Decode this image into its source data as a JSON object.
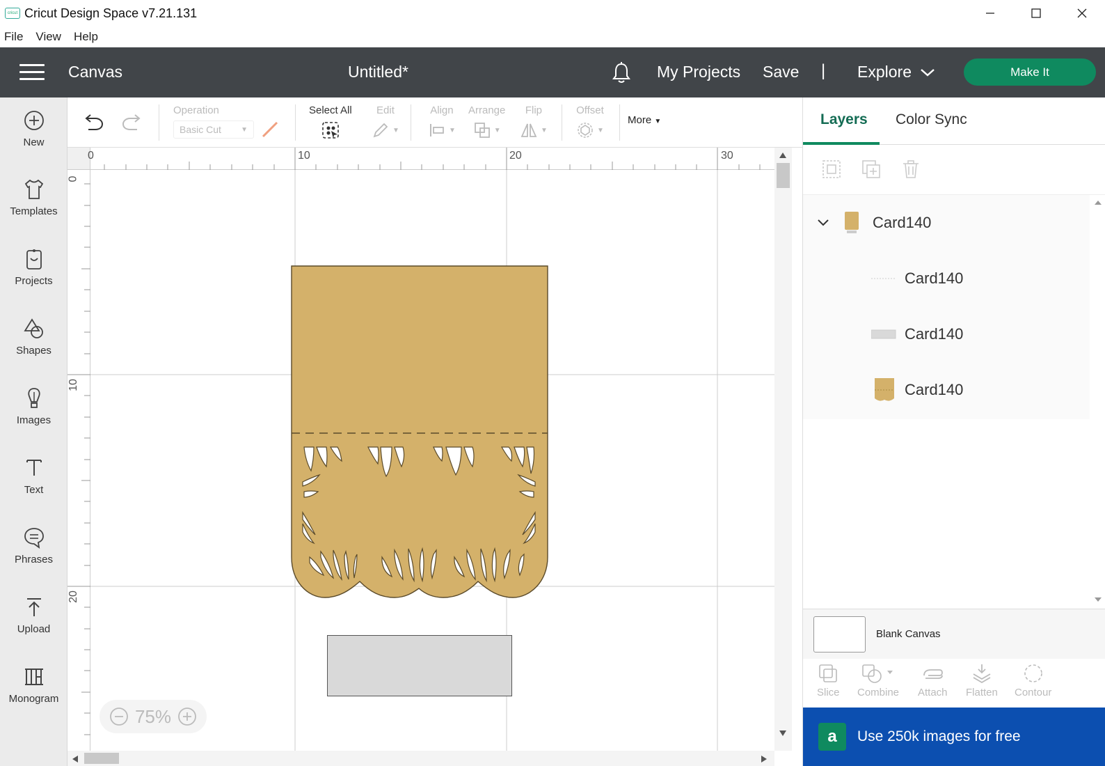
{
  "window": {
    "title": "Cricut Design Space  v7.21.131",
    "logo_text": "cricut"
  },
  "menubar": {
    "items": [
      "File",
      "View",
      "Help"
    ]
  },
  "header": {
    "section": "Canvas",
    "document_title": "Untitled*",
    "my_projects": "My Projects",
    "save": "Save",
    "separator": "|",
    "explore": "Explore",
    "make_it": "Make It"
  },
  "sidebar": {
    "items": [
      {
        "label": "New",
        "icon": "plus-circle-icon"
      },
      {
        "label": "Templates",
        "icon": "tshirt-icon"
      },
      {
        "label": "Projects",
        "icon": "projects-icon"
      },
      {
        "label": "Shapes",
        "icon": "shapes-icon"
      },
      {
        "label": "Images",
        "icon": "lightbulb-icon"
      },
      {
        "label": "Text",
        "icon": "text-icon"
      },
      {
        "label": "Phrases",
        "icon": "speech-bubble-icon"
      },
      {
        "label": "Upload",
        "icon": "upload-icon"
      },
      {
        "label": "Monogram",
        "icon": "monogram-icon"
      }
    ]
  },
  "toolbar": {
    "operation_label": "Operation",
    "operation_value": "Basic Cut",
    "select_all": "Select All",
    "edit": "Edit",
    "align": "Align",
    "arrange": "Arrange",
    "flip": "Flip",
    "offset": "Offset",
    "more": "More"
  },
  "canvas": {
    "ruler_top": [
      "0",
      "10",
      "20",
      "30"
    ],
    "ruler_left": [
      "0",
      "10",
      "20"
    ],
    "zoom": "75%",
    "card_fill": "#d4b16a",
    "rect_fill": "#d9d9d9"
  },
  "panel": {
    "tabs": [
      "Layers",
      "Color Sync"
    ],
    "layers": [
      {
        "name": "Card140",
        "level": 0,
        "type": "group"
      },
      {
        "name": "Card140",
        "level": 1,
        "type": "score"
      },
      {
        "name": "Card140",
        "level": 1,
        "type": "rect"
      },
      {
        "name": "Card140",
        "level": 1,
        "type": "card"
      }
    ],
    "blank_canvas": "Blank Canvas",
    "tools": [
      "Slice",
      "Combine",
      "Attach",
      "Flatten",
      "Contour"
    ],
    "promo": "Use 250k images for free",
    "promo_badge": "a"
  },
  "colors": {
    "header": "#414549",
    "accent": "#0f8a5f",
    "promo": "#0c4fb0"
  }
}
